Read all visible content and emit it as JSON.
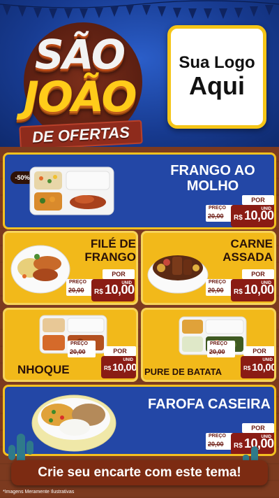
{
  "header": {
    "title_line1": "SÃO",
    "title_line2": "JOÃO",
    "title_line3": "DE OFERTAS",
    "logo_line1": "Sua Logo",
    "logo_line2": "Aqui"
  },
  "price_labels": {
    "por": "POR",
    "preco": "PREÇO",
    "rs": "R$",
    "unid": "UNID"
  },
  "products": [
    {
      "name_line1": "FRANGO AO",
      "name_line2": "MOLHO",
      "old_price": "20,00",
      "price": "10,00",
      "discount": "-50%"
    },
    {
      "name_line1": "FILÉ DE",
      "name_line2": "FRANGO",
      "old_price": "20,00",
      "price": "10,00"
    },
    {
      "name_line1": "CARNE",
      "name_line2": "ASSADA",
      "old_price": "20,00",
      "price": "10,00"
    },
    {
      "name_line1": "NHOQUE",
      "old_price": "20,00",
      "price": "10,00"
    },
    {
      "name_line1": "PURE DE BATATA",
      "old_price": "20,00",
      "price": "10,00"
    },
    {
      "name_line1": "FAROFA CASEIRA",
      "old_price": "20,00",
      "price": "10,00"
    }
  ],
  "footer": {
    "banner": "Crie seu encarte com este tema!",
    "disclaimer": "*Imagens Meramente Ilustrativas"
  },
  "colors": {
    "header_blue": "#1d3f9a",
    "card_blue": "#2347a6",
    "card_yellow": "#f2b91a",
    "price_red": "#8a1c14",
    "wood_brown": "#7c3a1f"
  }
}
